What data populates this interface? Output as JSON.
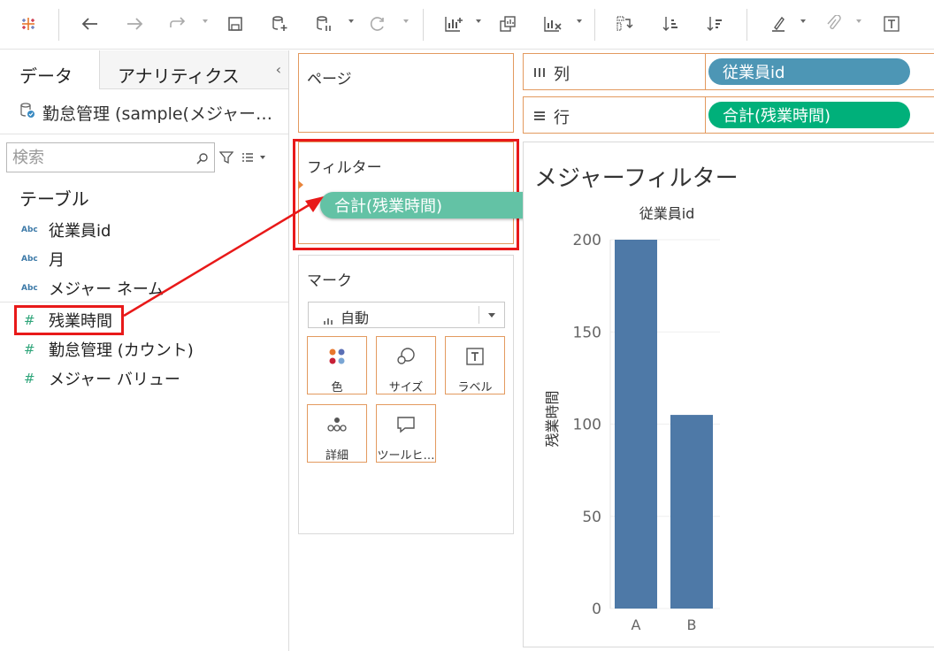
{
  "toolbar": {
    "icons": [
      "tableau-logo-icon",
      "undo-icon",
      "redo-icon",
      "replay-icon",
      "save-icon",
      "new-datasource-icon",
      "pause-icon",
      "refresh-icon",
      "new-worksheet-icon",
      "duplicate-icon",
      "clear-icon",
      "swap-icon",
      "sort-ascending-icon",
      "sort-descending-icon",
      "highlight-icon",
      "group-icon",
      "label-icon"
    ]
  },
  "datapane": {
    "tab_data": "データ",
    "tab_analytics": "アナリティクス",
    "datasource_name": "勤怠管理 (sample(メジャー…",
    "search_placeholder": "検索",
    "section_title": "テーブル",
    "fields": [
      {
        "type": "Abc",
        "name": "従業員id"
      },
      {
        "type": "Abc",
        "name": "月"
      },
      {
        "type": "Abc",
        "name": "メジャー ネーム"
      },
      {
        "type": "#",
        "name": "残業時間"
      },
      {
        "type": "#",
        "name": "勤怠管理 (カウント)"
      },
      {
        "type": "#",
        "name": "メジャー バリュー"
      }
    ]
  },
  "shelves": {
    "pages_title": "ページ",
    "filters_title": "フィルター",
    "filter_pill": "合計(残業時間)",
    "marks_title": "マーク",
    "mark_type": "自動",
    "mark_buttons": [
      "色",
      "サイズ",
      "ラベル",
      "詳細",
      "ツールヒ…"
    ],
    "columns_label": "列",
    "columns_pill": "従業員id",
    "rows_label": "行",
    "rows_pill": "合計(残業時間)"
  },
  "viz": {
    "title": "メジャーフィルター"
  },
  "colors": {
    "bar": "#4e79a7",
    "shelf_border": "#e39a5f",
    "highlight": "#e81919",
    "dimension_pill": "#4d96b5",
    "measure_pill": "#00b07a"
  },
  "chart_data": {
    "type": "bar",
    "title": "メジャーフィルター",
    "header": "従業員id",
    "categories": [
      "A",
      "B"
    ],
    "values": [
      200,
      105
    ],
    "ylabel": "残業時間",
    "yticks": [
      "0",
      "50",
      "100",
      "150",
      "200"
    ],
    "ylim": [
      0,
      200
    ]
  }
}
